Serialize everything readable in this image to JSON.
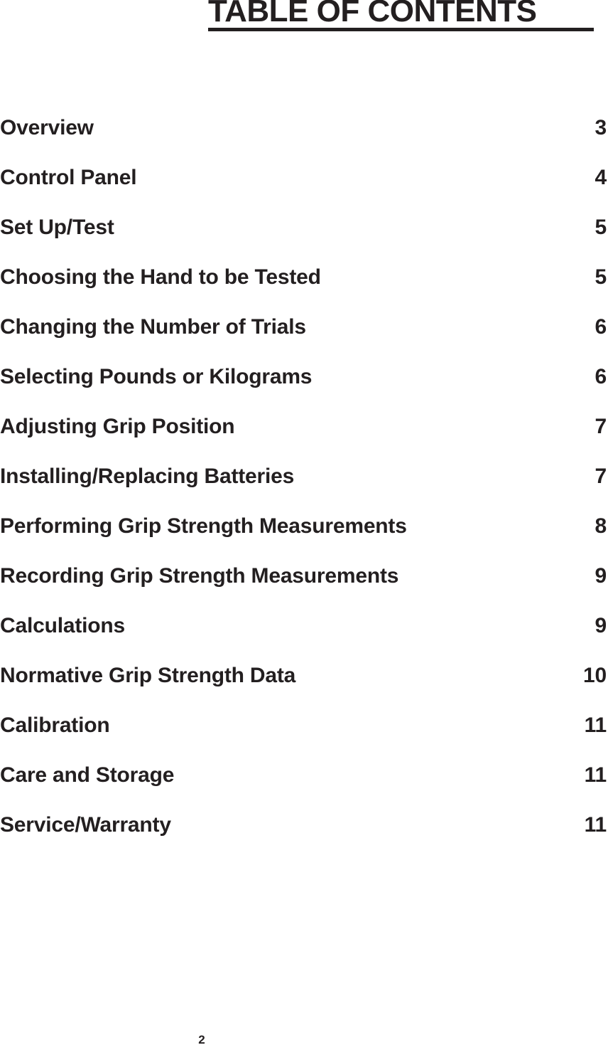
{
  "document": {
    "title": "TABLE OF CONTENTS",
    "footer_page_number": "2"
  },
  "contents": {
    "entries": [
      {
        "title": "Overview",
        "page": "3"
      },
      {
        "title": "Control Panel",
        "page": "4"
      },
      {
        "title": "Set Up/Test",
        "page": "5"
      },
      {
        "title": "Choosing the Hand to be Tested",
        "page": "5"
      },
      {
        "title": "Changing the Number of Trials",
        "page": "6"
      },
      {
        "title": "Selecting Pounds or Kilograms",
        "page": "6"
      },
      {
        "title": "Adjusting Grip Position",
        "page": "7"
      },
      {
        "title": "Installing/Replacing Batteries",
        "page": "7"
      },
      {
        "title": "Performing Grip Strength Measurements",
        "page": "8"
      },
      {
        "title": "Recording Grip Strength Measurements",
        "page": "9"
      },
      {
        "title": "Calculations",
        "page": "9"
      },
      {
        "title": "Normative Grip Strength Data",
        "page": "10"
      },
      {
        "title": "Calibration",
        "page": "11"
      },
      {
        "title": "Care and Storage",
        "page": "11"
      },
      {
        "title": "Service/Warranty",
        "page": "11"
      }
    ]
  },
  "colors": {
    "text": "#231f20",
    "background": "#ffffff"
  }
}
